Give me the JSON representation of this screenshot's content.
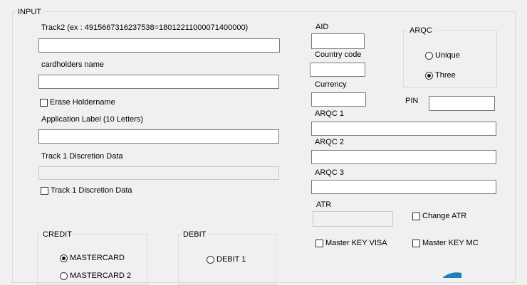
{
  "input_group": {
    "title": "INPUT",
    "track2_label": "Track2 (ex : 4915667316237538=1801221100007140000​0)",
    "track2_value": "",
    "cardholder_label": "cardholders name",
    "cardholder_value": "",
    "erase_holdername_label": "Erase Holdername",
    "app_label_label": "Application Label (10 Letters)",
    "app_label_value": "",
    "track1_disc_label": "Track 1 Discretion Data",
    "track1_disc_value": "",
    "track1_disc_check_label": "Track 1 Discretion Data",
    "aid_label": "AID",
    "aid_value": "",
    "country_code_label": "Country code",
    "country_code_value": "",
    "currency_label": "Currency",
    "currency_value": "",
    "pin_label": "PIN",
    "pin_value": "",
    "arqc1_label": "ARQC 1",
    "arqc1_value": "",
    "arqc2_label": "ARQC 2",
    "arqc2_value": "",
    "arqc3_label": "ARQC 3",
    "arqc3_value": "",
    "atr_label": "ATR",
    "atr_value": "",
    "change_atr_label": "Change ATR",
    "master_key_visa_label": "Master KEY VISA",
    "master_key_mc_label": "Master KEY MC"
  },
  "arqc_group": {
    "title": "ARQC",
    "options": [
      {
        "label": "Unique",
        "selected": false
      },
      {
        "label": "Three",
        "selected": true
      }
    ]
  },
  "credit_group": {
    "title": "CREDIT",
    "options": [
      {
        "label": "MASTERCARD",
        "selected": true
      },
      {
        "label": "MASTERCARD 2",
        "selected": false
      }
    ]
  },
  "debit_group": {
    "title": "DEBIT",
    "options": [
      {
        "label": "DEBIT 1",
        "selected": false
      }
    ]
  },
  "colors": {
    "background": "#f0f0f0",
    "group_border": "#dcdcdc",
    "textbox_border": "#7a7a7a",
    "accent_graphic": "#1e7fbf"
  }
}
